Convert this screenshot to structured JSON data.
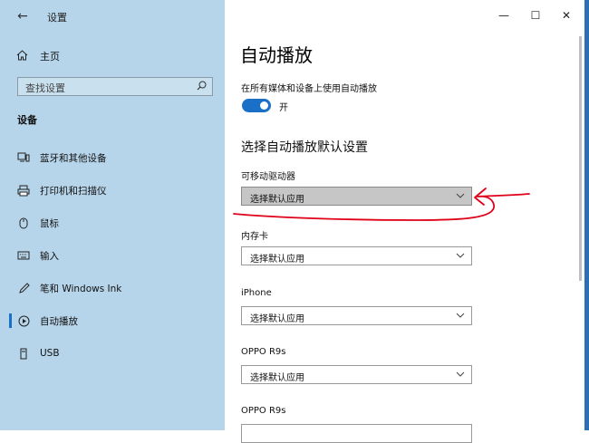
{
  "window": {
    "title": "设置",
    "controls": {
      "minimize": "—",
      "maximize": "☐",
      "close": "✕"
    }
  },
  "sidebar": {
    "back_glyph": "←",
    "home_label": "主页",
    "search_placeholder": "查找设置",
    "section_title": "设备",
    "items": [
      {
        "label": "蓝牙和其他设备",
        "icon": "bluetooth-devices-icon"
      },
      {
        "label": "打印机和扫描仪",
        "icon": "printer-icon"
      },
      {
        "label": "鼠标",
        "icon": "mouse-icon"
      },
      {
        "label": "输入",
        "icon": "keyboard-icon"
      },
      {
        "label": "笔和 Windows Ink",
        "icon": "pen-icon"
      },
      {
        "label": "自动播放",
        "icon": "autoplay-icon",
        "active": true
      },
      {
        "label": "USB",
        "icon": "usb-icon"
      }
    ]
  },
  "main": {
    "title": "自动播放",
    "toggle_description": "在所有媒体和设备上使用自动播放",
    "toggle_state": "开",
    "toggle_on": true,
    "section_title": "选择自动播放默认设置",
    "fields": [
      {
        "label": "可移动驱动器",
        "value": "选择默认应用"
      },
      {
        "label": "内存卡",
        "value": "选择默认应用"
      },
      {
        "label": "iPhone",
        "value": "选择默认应用"
      },
      {
        "label": "OPPO R9s",
        "value": "选择默认应用"
      },
      {
        "label": "OPPO R9s",
        "value": ""
      }
    ]
  },
  "colors": {
    "accent": "#1a6fc7",
    "sidebar_bg": "#b7d5ea",
    "annotation": "#e0001a"
  }
}
